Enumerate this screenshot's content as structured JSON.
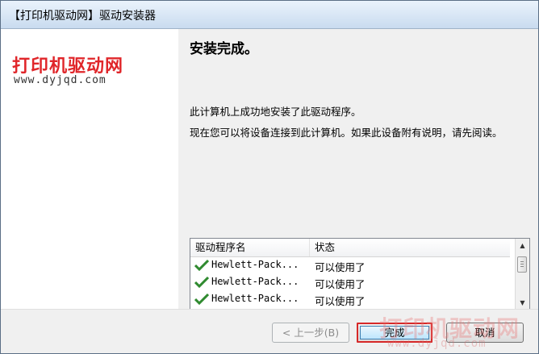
{
  "window": {
    "title": "【打印机驱动网】驱动安装器"
  },
  "branding": {
    "name": "打印机驱动网",
    "url": "www.dyjqd.com"
  },
  "content": {
    "heading": "安装完成。",
    "message1": "此计算机上成功地安装了此驱动程序。",
    "message2": "现在您可以将设备连接到此计算机。如果此设备附有说明，请先阅读。"
  },
  "driver_list": {
    "columns": [
      "驱动程序名",
      "状态"
    ],
    "rows": [
      {
        "name": "Hewlett-Pack...",
        "status": "可以使用了"
      },
      {
        "name": "Hewlett-Pack...",
        "status": "可以使用了"
      },
      {
        "name": "Hewlett-Pack...",
        "status": "可以使用了"
      }
    ]
  },
  "buttons": {
    "back": "< 上一步(B)",
    "finish": "完成",
    "cancel": "取消"
  },
  "watermark": {
    "text": "打印机驱动网",
    "url": "www.dyjqd.com"
  },
  "colors": {
    "brand_red": "#e0262a",
    "check_green": "#2f8a2f",
    "highlight_border": "#d62828"
  }
}
